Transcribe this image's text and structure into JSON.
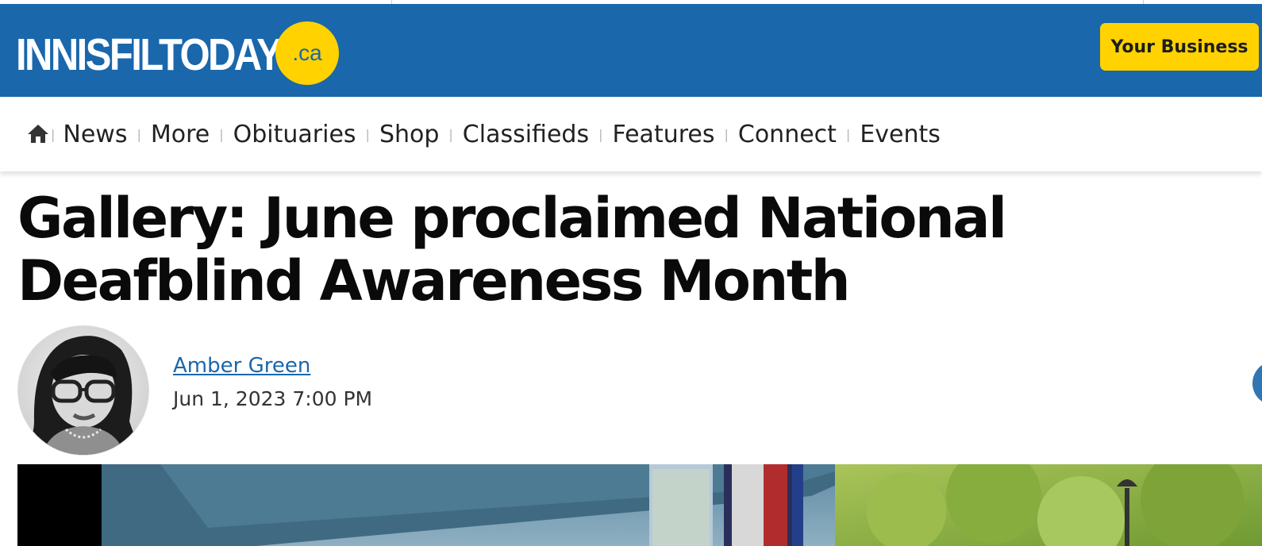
{
  "header": {
    "logo_main": "INNISFILTODAY",
    "logo_suffix": ".ca",
    "business_button": "Your Business"
  },
  "nav": {
    "items": [
      "News",
      "More",
      "Obituaries",
      "Shop",
      "Classifieds",
      "Features",
      "Connect",
      "Events"
    ]
  },
  "article": {
    "title": "Gallery: June proclaimed National Deafblind Awareness Month",
    "author": "Amber Green",
    "date": "Jun 1, 2023 7:00 PM"
  },
  "colors": {
    "brand_blue": "#1a67ab",
    "brand_yellow": "#ffd200"
  },
  "icons": {
    "home": "home-icon"
  }
}
